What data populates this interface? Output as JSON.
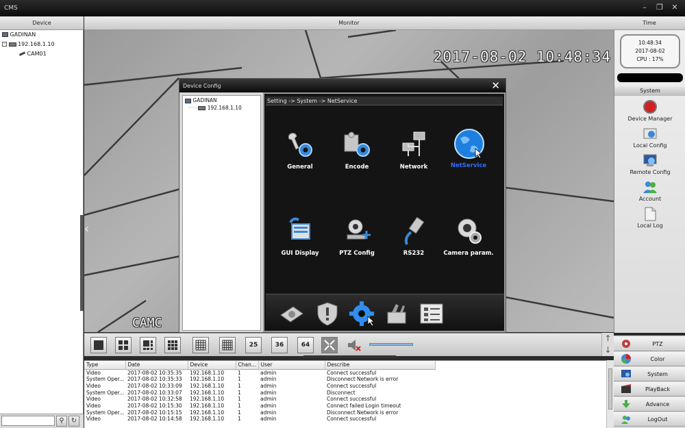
{
  "window": {
    "title": "CMS"
  },
  "headers": {
    "device": "Device",
    "monitor": "Monitor",
    "time": "Time"
  },
  "device_tree": {
    "root": "GADINAN",
    "ip": "192.168.1.10",
    "camera": "CAM01"
  },
  "monitor": {
    "osd_time": "2017-08-02 10:48:34",
    "osd_cam": "CAMC"
  },
  "dialog": {
    "title": "Device Config",
    "tree_root": "GADINAN",
    "tree_ip": "192.168.1.10",
    "breadcrumb": "Setting -> System -> NetService",
    "items": [
      {
        "label": "General",
        "icon": "wrench-gear-icon"
      },
      {
        "label": "Encode",
        "icon": "puzzle-gear-icon"
      },
      {
        "label": "Network",
        "icon": "network-icon"
      },
      {
        "label": "NetService",
        "icon": "globe-icon",
        "active": true
      },
      {
        "label": "GUI Display",
        "icon": "display-icon"
      },
      {
        "label": "PTZ Config",
        "icon": "ptz-camera-icon"
      },
      {
        "label": "RS232",
        "icon": "cable-icon"
      },
      {
        "label": "Camera param.",
        "icon": "camera-gear-icon"
      }
    ]
  },
  "clock": {
    "time": "10:48:34",
    "date": "2017-08-02",
    "cpu": "CPU : 17%"
  },
  "system_panel": {
    "header": "System",
    "items": [
      {
        "label": "Device Manager",
        "icon": "record-icon"
      },
      {
        "label": "Local Config",
        "icon": "local-config-icon"
      },
      {
        "label": "Remote Config",
        "icon": "remote-config-icon"
      },
      {
        "label": "Account",
        "icon": "account-icon"
      },
      {
        "label": "Local Log",
        "icon": "log-icon"
      }
    ]
  },
  "layout_buttons": {
    "n25": "25",
    "n36": "36",
    "n64": "64"
  },
  "log": {
    "columns": [
      "Type",
      "Date",
      "Device",
      "Chan...",
      "User",
      "Describe"
    ],
    "rows": [
      [
        "Video",
        "2017-08-02 10:35:35",
        "192.168.1.10",
        "1",
        "admin",
        "Connect successful"
      ],
      [
        "System Oper...",
        "2017-08-02 10:35:33",
        "192.168.1.10",
        "1",
        "admin",
        "Disconnect Network is error"
      ],
      [
        "Video",
        "2017-08-02 10:33:09",
        "192.168.1.10",
        "1",
        "admin",
        "Connect successful"
      ],
      [
        "System Oper...",
        "2017-08-02 10:33:07",
        "192.168.1.10",
        "1",
        "admin",
        "Disconnect"
      ],
      [
        "Video",
        "2017-08-02 10:32:58",
        "192.168.1.10",
        "1",
        "admin",
        "Connect successful"
      ],
      [
        "Video",
        "2017-08-02 10:15:30",
        "192.168.1.10",
        "1",
        "admin",
        "Connect failed Login timeout"
      ],
      [
        "System Oper...",
        "2017-08-02 10:15:15",
        "192.168.1.10",
        "1",
        "admin",
        "Disconnect Network is error"
      ],
      [
        "Video",
        "2017-08-02 10:14:58",
        "192.168.1.10",
        "1",
        "admin",
        "Connect successful"
      ]
    ]
  },
  "bottom_buttons": [
    {
      "label": "PTZ",
      "icon": "ptz-icon"
    },
    {
      "label": "Color",
      "icon": "color-icon"
    },
    {
      "label": "System",
      "icon": "system-icon"
    },
    {
      "label": "PlayBack",
      "icon": "playback-icon"
    },
    {
      "label": "Advance",
      "icon": "advance-icon"
    },
    {
      "label": "LogOut",
      "icon": "logout-icon"
    }
  ]
}
